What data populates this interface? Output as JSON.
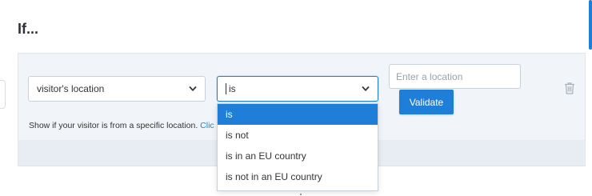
{
  "heading": "If...",
  "condition": {
    "field_select": {
      "value": "visitor's location"
    },
    "operator_select": {
      "value": "is"
    },
    "location_input": {
      "placeholder": "Enter a location",
      "value": ""
    },
    "validate_label": "Validate",
    "help": {
      "text": "Show if your visitor is from a specific location. ",
      "link": "Clic"
    }
  },
  "dropdown": {
    "options": [
      "is",
      "is not",
      "is in an EU country",
      "is not in an EU country"
    ],
    "selected": "is"
  },
  "colors": {
    "accent": "#1f7fd8",
    "card_bg": "#f1f5f9"
  },
  "icons": {
    "chevron": "chevron-down-icon",
    "trash": "trash-icon"
  }
}
